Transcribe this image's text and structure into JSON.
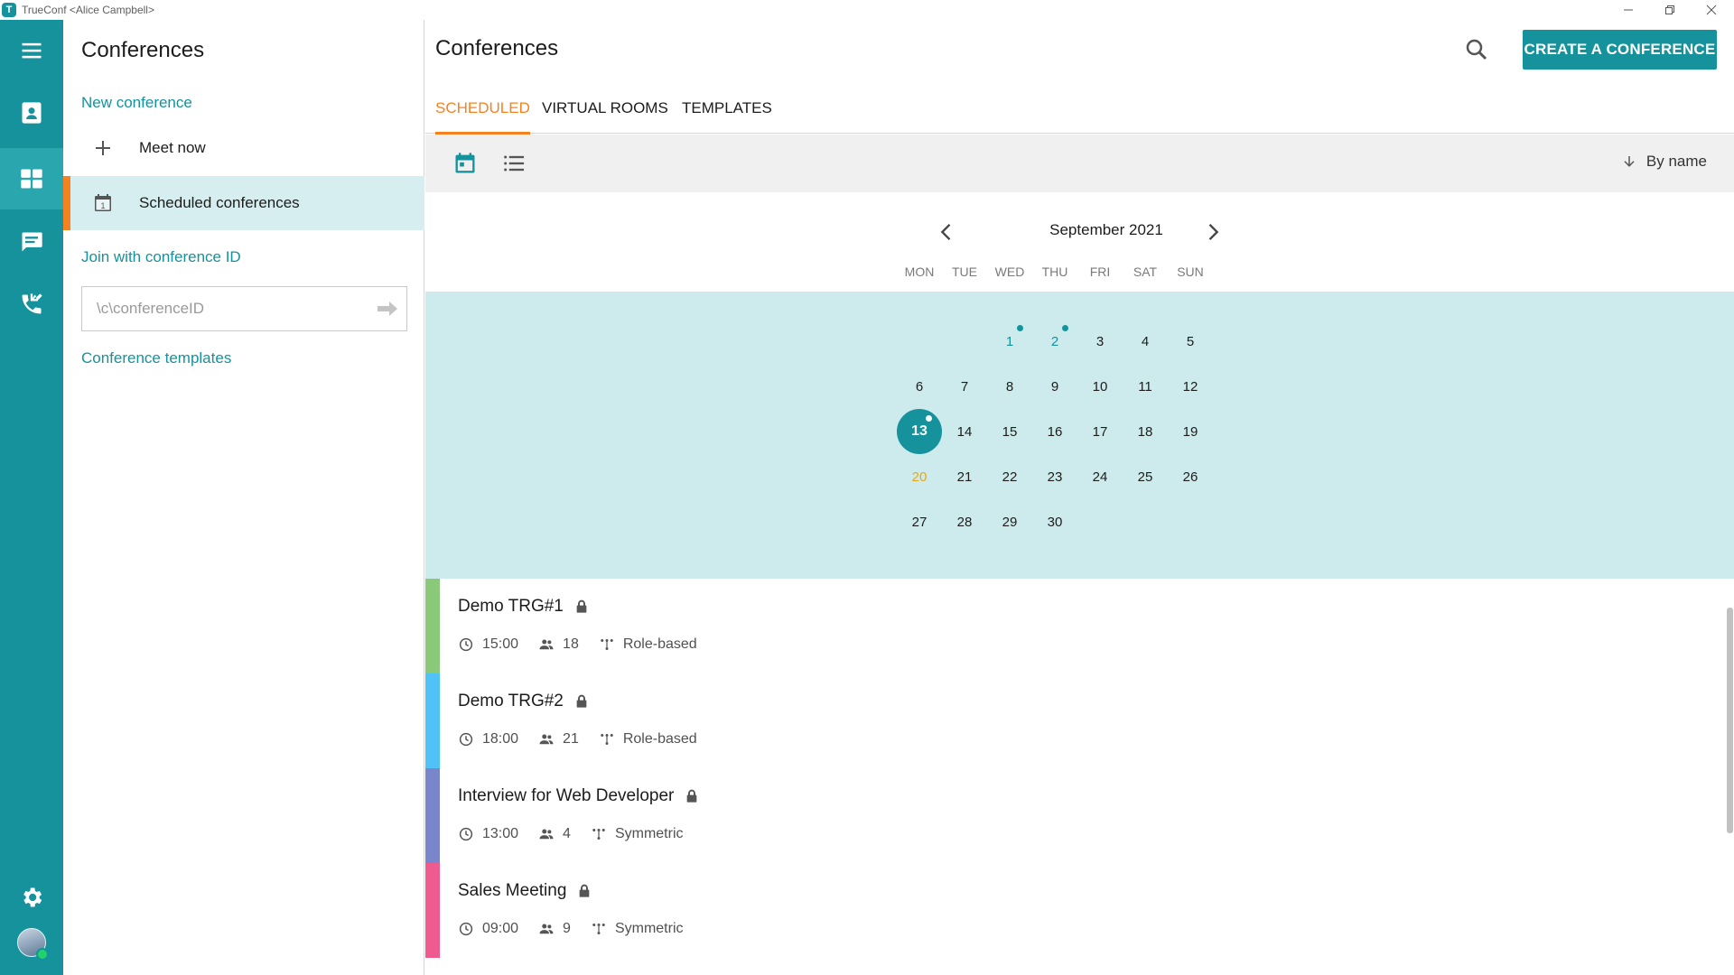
{
  "window": {
    "title": "TrueConf <Alice Campbell>",
    "app_icon": "trueconf-logo-icon"
  },
  "rail": {
    "items": [
      "menu-icon",
      "contacts-icon",
      "conferences-icon",
      "chat-icon",
      "call-history-icon"
    ],
    "active": "conferences-icon",
    "bottom": [
      "settings-icon",
      "avatar"
    ]
  },
  "sidebar": {
    "title": "Conferences",
    "new_conference": "New conference",
    "meet_now": "Meet now",
    "scheduled": "Scheduled conferences",
    "scheduled_icon_text": "1",
    "join_label": "Join with conference ID",
    "id_placeholder": "\\c\\conferenceID",
    "templates": "Conference templates"
  },
  "main": {
    "title": "Conferences",
    "create_button": "CREATE A CONFERENCE",
    "tabs": [
      {
        "label": "SCHEDULED"
      },
      {
        "label": "VIRTUAL ROOMS"
      },
      {
        "label": "TEMPLATES"
      }
    ],
    "active_tab": "SCHEDULED",
    "sort_label": "By name"
  },
  "calendar": {
    "month": "September 2021",
    "weekdays": [
      "MON",
      "TUE",
      "WED",
      "THU",
      "FRI",
      "SAT",
      "SUN"
    ],
    "days": [
      "1",
      "2",
      "3",
      "4",
      "5",
      "6",
      "7",
      "8",
      "9",
      "10",
      "11",
      "12",
      "13",
      "14",
      "15",
      "16",
      "17",
      "18",
      "19",
      "20",
      "21",
      "22",
      "23",
      "24",
      "25",
      "26",
      "27",
      "28",
      "29",
      "30"
    ],
    "event_days": [
      "1",
      "2",
      "13"
    ],
    "today": "13",
    "highlight_day": "20"
  },
  "conferences": [
    {
      "name": "Demo TRG#1",
      "time": "15:00",
      "participants": "18",
      "mode": "Role-based",
      "color": "#8bc97a"
    },
    {
      "name": "Demo TRG#2",
      "time": "18:00",
      "participants": "21",
      "mode": "Role-based",
      "color": "#4fc3f7"
    },
    {
      "name": "Interview for Web Developer",
      "time": "13:00",
      "participants": "4",
      "mode": "Symmetric",
      "color": "#7986cb"
    },
    {
      "name": "Sales Meeting",
      "time": "09:00",
      "participants": "9",
      "mode": "Symmetric",
      "color": "#ef5b8f"
    }
  ],
  "colors": {
    "accent": "#15929b",
    "active_tab": "#f5821f",
    "calendar_bg": "#cdebec",
    "holiday": "#e5a81a"
  }
}
